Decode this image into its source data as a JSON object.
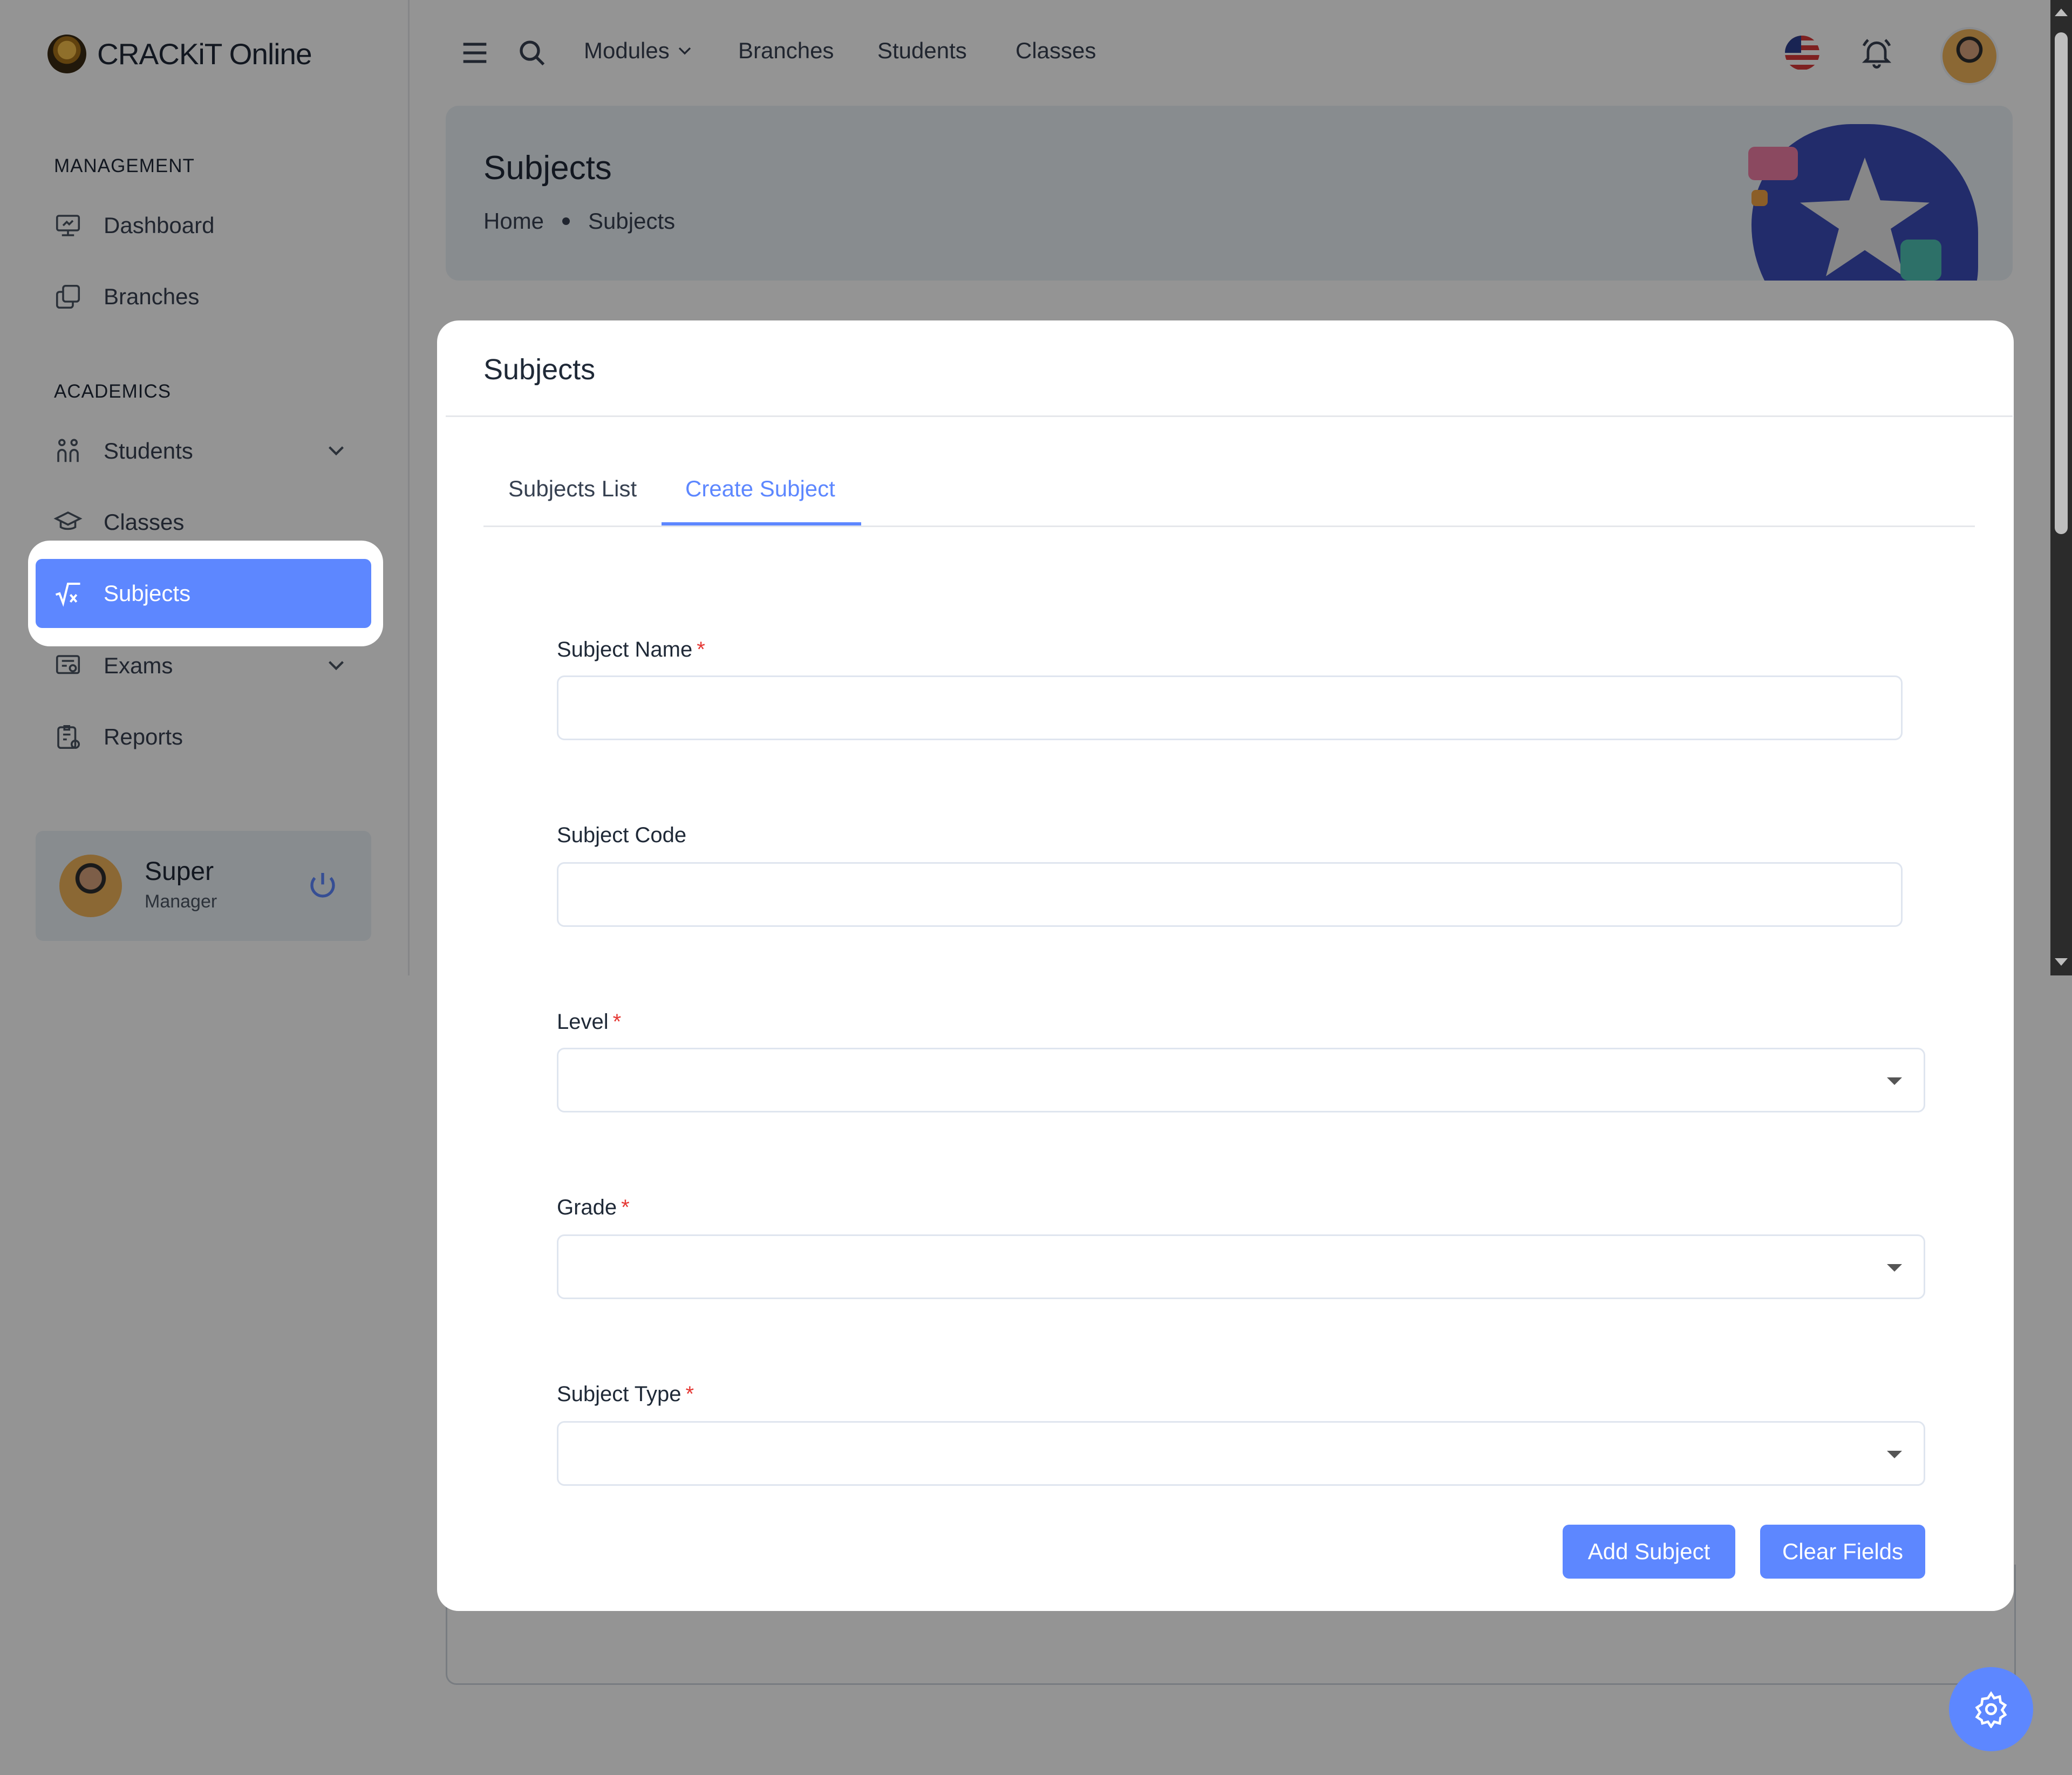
{
  "app": {
    "brand": "CRACKiT Online"
  },
  "sidebar": {
    "sections": [
      {
        "title": "MANAGEMENT"
      },
      {
        "title": "ACADEMICS"
      }
    ],
    "items": [
      {
        "label": "Dashboard",
        "icon": "dashboard-icon"
      },
      {
        "label": "Branches",
        "icon": "copy-icon"
      },
      {
        "label": "Students",
        "icon": "users-icon",
        "has_submenu": true
      },
      {
        "label": "Classes",
        "icon": "graduation-cap-icon"
      },
      {
        "label": "Subjects",
        "icon": "square-root-icon",
        "active": true
      },
      {
        "label": "Exams",
        "icon": "certificate-icon",
        "has_submenu": true
      },
      {
        "label": "Reports",
        "icon": "clipboard-icon"
      }
    ],
    "user": {
      "name": "Super",
      "role": "Manager"
    }
  },
  "topbar": {
    "links": [
      {
        "label": "Modules",
        "has_dropdown": true
      },
      {
        "label": "Branches"
      },
      {
        "label": "Students"
      },
      {
        "label": "Classes"
      }
    ]
  },
  "header": {
    "title": "Subjects",
    "breadcrumb": [
      "Home",
      "Subjects"
    ]
  },
  "card": {
    "title": "Subjects",
    "tabs": [
      {
        "label": "Subjects List",
        "active": false
      },
      {
        "label": "Create Subject",
        "active": true
      }
    ],
    "form": {
      "subject_name": {
        "label": "Subject Name",
        "required": "*",
        "value": ""
      },
      "subject_code": {
        "label": "Subject Code",
        "value": ""
      },
      "level": {
        "label": "Level",
        "required": "*",
        "value": ""
      },
      "grade": {
        "label": "Grade",
        "required": "*",
        "value": ""
      },
      "subject_type": {
        "label": "Subject Type",
        "required": "*",
        "value": ""
      }
    },
    "buttons": {
      "add": "Add Subject",
      "clear": "Clear Fields"
    }
  },
  "colors": {
    "primary": "#5d87ff",
    "required": "#e53935",
    "overlay": "rgba(0,0,0,0.42)"
  }
}
